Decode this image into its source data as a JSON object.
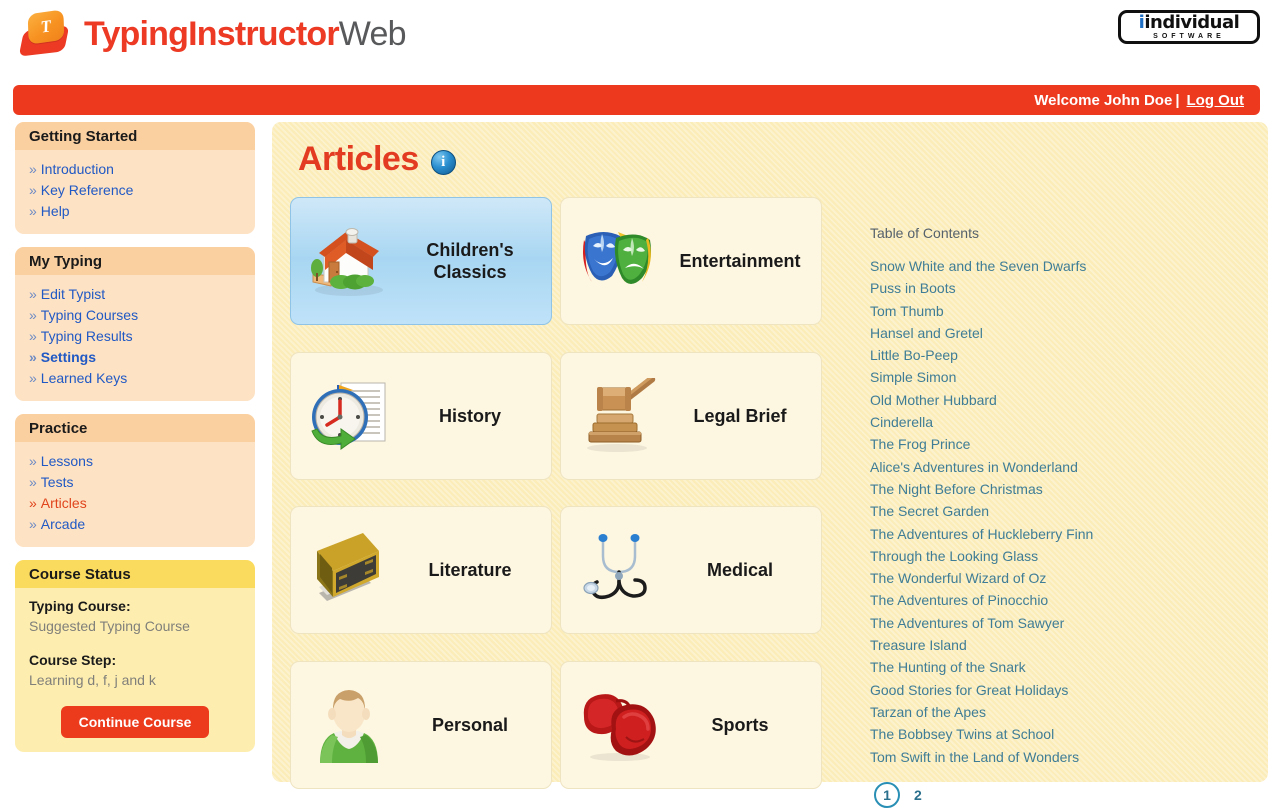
{
  "brand": {
    "name_part1": "TypingInstructor",
    "name_part2": "Web",
    "key_letter": "T",
    "logo_icon": "typing-key-logo"
  },
  "corporate_logo": {
    "main": "individual",
    "main_lead": "i",
    "sub": "SOFTWARE"
  },
  "welcome_bar": {
    "greeting": "Welcome John Doe",
    "separator": "|",
    "logout_label": "Log Out"
  },
  "sidebar": {
    "sections": [
      {
        "title": "Getting Started",
        "style": "peach",
        "items": [
          {
            "label": "Introduction",
            "state": "normal"
          },
          {
            "label": "Key Reference",
            "state": "normal"
          },
          {
            "label": "Help",
            "state": "normal"
          }
        ]
      },
      {
        "title": "My Typing",
        "style": "peach",
        "items": [
          {
            "label": "Edit Typist",
            "state": "normal"
          },
          {
            "label": "Typing Courses",
            "state": "normal"
          },
          {
            "label": "Typing Results",
            "state": "normal"
          },
          {
            "label": "Settings",
            "state": "bold"
          },
          {
            "label": "Learned Keys",
            "state": "normal"
          }
        ]
      },
      {
        "title": "Practice",
        "style": "peach",
        "items": [
          {
            "label": "Lessons",
            "state": "normal"
          },
          {
            "label": "Tests",
            "state": "normal"
          },
          {
            "label": "Articles",
            "state": "active"
          },
          {
            "label": "Arcade",
            "state": "normal"
          }
        ]
      }
    ],
    "chevron": "»",
    "course_status": {
      "title": "Course Status",
      "typing_course_label": "Typing Course:",
      "typing_course_value": "Suggested Typing Course",
      "course_step_label": "Course Step:",
      "course_step_value": "Learning d, f, j and k",
      "continue_button": "Continue Course"
    }
  },
  "main": {
    "title": "Articles",
    "info_icon": "info-icon",
    "info_glyph": "i",
    "categories": [
      {
        "label": "Children's Classics",
        "icon": "house-icon",
        "selected": true
      },
      {
        "label": "Entertainment",
        "icon": "theater-masks-icon",
        "selected": false
      },
      {
        "label": "History",
        "icon": "clock-document-icon",
        "selected": false
      },
      {
        "label": "Legal Brief",
        "icon": "gavel-icon",
        "selected": false
      },
      {
        "label": "Literature",
        "icon": "book-icon",
        "selected": false
      },
      {
        "label": "Medical",
        "icon": "stethoscope-icon",
        "selected": false
      },
      {
        "label": "Personal",
        "icon": "person-icon",
        "selected": false
      },
      {
        "label": "Sports",
        "icon": "boxing-gloves-icon",
        "selected": false
      }
    ],
    "toc": {
      "title": "Table of Contents",
      "items": [
        "Snow White and the Seven Dwarfs",
        "Puss in Boots",
        "Tom Thumb",
        "Hansel and Gretel",
        "Little Bo-Peep",
        "Simple Simon",
        "Old Mother Hubbard",
        "Cinderella",
        "The Frog Prince",
        "Alice's Adventures in Wonderland",
        "The Night Before Christmas",
        "The Secret Garden",
        "The Adventures of Huckleberry Finn",
        "Through the Looking Glass",
        "The Wonderful Wizard of Oz",
        "The Adventures of Pinocchio",
        "The Adventures of Tom Sawyer",
        "Treasure Island",
        "The Hunting of the Snark",
        "Good Stories for Great Holidays",
        "Tarzan of the Apes",
        "The Bobbsey Twins at School",
        "Tom Swift in the Land of Wonders"
      ],
      "pages": [
        {
          "label": "1",
          "current": true
        },
        {
          "label": "2",
          "current": false
        }
      ]
    }
  },
  "colors": {
    "brand_red": "#ec3a24",
    "brand_gray": "#58595b",
    "welcome_bar": "#ed3a1f",
    "sidebar_header_peach": "#fbd0a1",
    "sidebar_body_peach": "#fde2c4",
    "status_header_yellow": "#fbdb5e",
    "status_body_yellow": "#fdeeb0",
    "content_cream": "#fbecb8",
    "tile_cream": "#fdf6e0",
    "tile_selected_blue": "#a8d6f2",
    "link_blue": "#2159c4",
    "toc_teal": "#3f7d96",
    "active_link_red": "#e0451d"
  }
}
